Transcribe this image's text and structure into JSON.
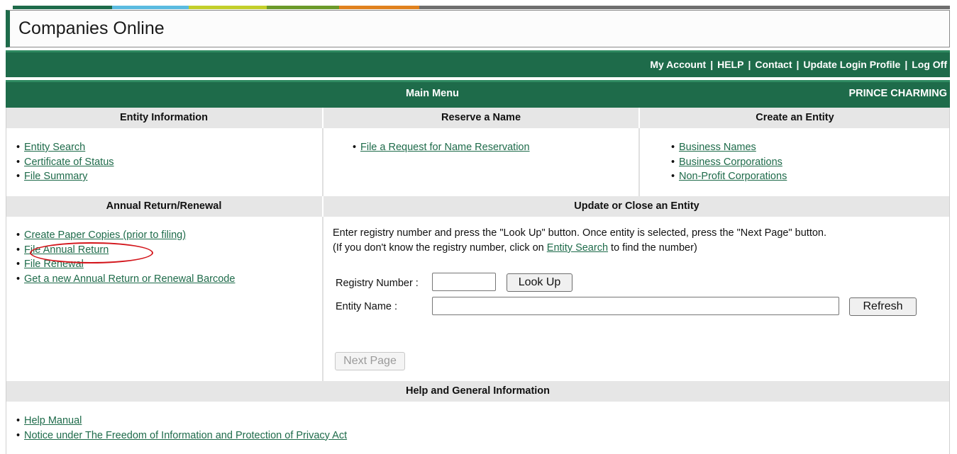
{
  "header": {
    "title": "Companies Online",
    "accent_colors": [
      "#1e6b4a",
      "#5bbbe0",
      "#c3cf2b",
      "#6b9a2a",
      "#e0821f",
      "#6f6f6f"
    ]
  },
  "top_nav": {
    "links": [
      "My Account",
      "HELP",
      "Contact",
      "Update Login Profile",
      "Log Off"
    ],
    "separator": "|"
  },
  "menu_bar": {
    "title": "Main Menu",
    "user": "PRINCE CHARMING"
  },
  "sections": {
    "entity_info": {
      "heading": "Entity Information",
      "links": [
        "Entity Search",
        "Certificate of Status",
        "File Summary"
      ]
    },
    "reserve_name": {
      "heading": "Reserve a Name",
      "links": [
        "File a Request for Name Reservation"
      ]
    },
    "create_entity": {
      "heading": "Create an Entity",
      "links": [
        "Business Names",
        "Business Corporations",
        "Non-Profit Corporations"
      ]
    },
    "annual_return": {
      "heading": "Annual Return/Renewal",
      "links": [
        "Create Paper Copies (prior to filing)",
        "File Annual Return",
        "File Renewal",
        "Get a new Annual Return or Renewal Barcode"
      ]
    },
    "update_close": {
      "heading": "Update or Close an Entity",
      "instructions_line1": "Enter registry number and press the \"Look Up\" button. Once entity is selected, press the \"Next Page\" button.",
      "instructions_line2_prefix": "(If you don't know the registry number, click on ",
      "instructions_line2_link": "Entity Search",
      "instructions_line2_suffix": " to find the number)",
      "registry_label": "Registry Number :",
      "registry_value": "",
      "lookup_button": "Look Up",
      "entity_name_label": "Entity Name :",
      "entity_name_value": "",
      "refresh_button": "Refresh",
      "next_page_button": "Next Page"
    },
    "help_info": {
      "heading": "Help and General Information",
      "links": [
        "Help Manual",
        "Notice under The Freedom of Information and Protection of Privacy Act"
      ]
    }
  },
  "highlight": {
    "color": "#d3151b",
    "target": "File Annual Return"
  }
}
